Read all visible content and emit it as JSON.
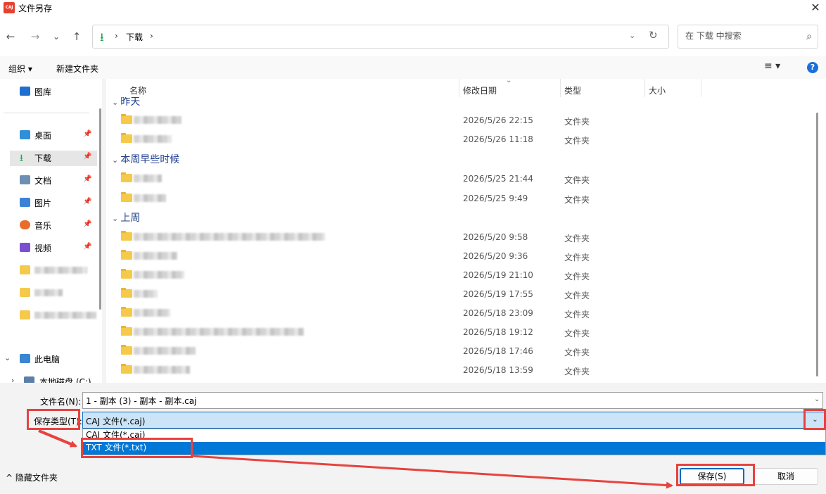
{
  "window": {
    "app_icon_text": "CAJ",
    "title": "文件另存",
    "close_glyph": "✕"
  },
  "nav": {
    "back": "←",
    "forward": "→",
    "recent": "⌄",
    "up": "↑"
  },
  "address": {
    "crumb_sep_1": "›",
    "folder": "下载",
    "crumb_sep_2": "›",
    "dropdown": "⌄",
    "refresh": "↻",
    "download_glyph": "⭳"
  },
  "search": {
    "placeholder": "在 下载 中搜索",
    "icon": "⌕"
  },
  "toolbar": {
    "organize": "组织 ▾",
    "new_folder": "新建文件夹",
    "view": "≡ ▾",
    "help": "?"
  },
  "sidebar": {
    "gallery": "图库",
    "quick": [
      {
        "label": "桌面",
        "color": "#2f8fd8"
      },
      {
        "label": "下载",
        "color": "#1fa24a"
      },
      {
        "label": "文档",
        "color": "#6d8fb3"
      },
      {
        "label": "图片",
        "color": "#3b82d6"
      },
      {
        "label": "音乐",
        "color": "#e86d2c"
      },
      {
        "label": "视频",
        "color": "#7a4fd0"
      }
    ],
    "this_pc": "此电脑",
    "local_disk": "本地磁盘 (C:)",
    "pin": "📌",
    "expand_chevron": "⌄",
    "collapse_chevron": "›"
  },
  "columns": {
    "name": "名称",
    "modified": "修改日期",
    "type": "类型",
    "size": "大小",
    "sort_caret": "⌄"
  },
  "groups": [
    {
      "title": "昨天",
      "rows": [
        {
          "date": "2026/5/26 22:15",
          "type": "文件夹"
        },
        {
          "date": "2026/5/26 11:18",
          "type": "文件夹"
        }
      ]
    },
    {
      "title": "本周早些时候",
      "rows": [
        {
          "date": "2026/5/25 21:44",
          "type": "文件夹"
        },
        {
          "date": "2026/5/25 9:49",
          "type": "文件夹"
        }
      ]
    },
    {
      "title": "上周",
      "rows": [
        {
          "date": "2026/5/20 9:58",
          "type": "文件夹"
        },
        {
          "date": "2026/5/20 9:36",
          "type": "文件夹"
        },
        {
          "date": "2026/5/19 21:10",
          "type": "文件夹"
        },
        {
          "date": "2026/5/19 17:55",
          "type": "文件夹"
        },
        {
          "date": "2026/5/18 23:09",
          "type": "文件夹"
        },
        {
          "date": "2026/5/18 19:12",
          "type": "文件夹"
        },
        {
          "date": "2026/5/18 17:46",
          "type": "文件夹"
        },
        {
          "date": "2026/5/18 13:59",
          "type": "文件夹"
        }
      ]
    }
  ],
  "form": {
    "filename_label": "文件名(N):",
    "filename_value": "1 - 副本 (3) - 副本 - 副本.caj",
    "filetype_label": "保存类型(T):",
    "filetype_value": "CAJ 文件(*.caj)",
    "filetype_options": [
      "CAJ 文件(*.caj)",
      "TXT 文件(*.txt)"
    ],
    "hide_folders": "^ 隐藏文件夹",
    "save": "保存(S)",
    "cancel": "取消",
    "caret": "⌄"
  },
  "annotation_color": "#e8423e"
}
